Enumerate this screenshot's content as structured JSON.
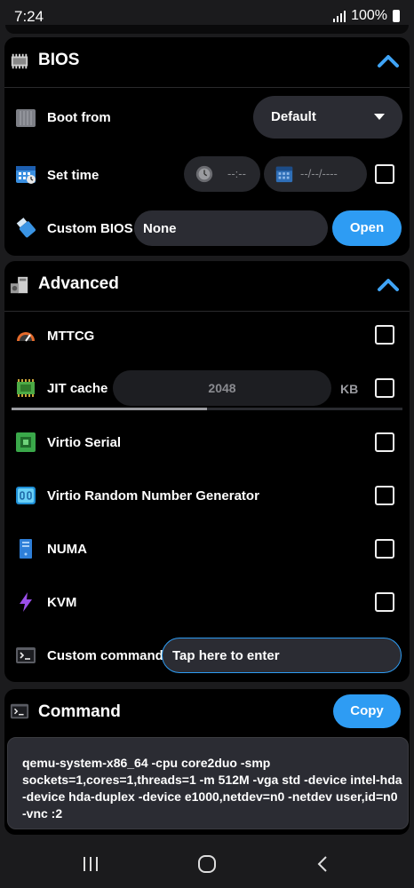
{
  "status": {
    "time": "7:24",
    "battery": "100%"
  },
  "bios": {
    "title": "BIOS",
    "boot_label": "Boot from",
    "boot_value": "Default",
    "settime_label": "Set time",
    "time_value": "--:--",
    "date_value": "--/--/----",
    "custom_bios_label": "Custom BIOS",
    "custom_bios_value": "None",
    "open_label": "Open"
  },
  "advanced": {
    "title": "Advanced",
    "mttcg_label": "MTTCG",
    "jit_label": "JIT cache",
    "jit_value": "2048",
    "jit_unit": "KB",
    "jit_progress": 0.5,
    "virtio_serial_label": "Virtio Serial",
    "virtio_rng_label": "Virtio Random Number Generator",
    "numa_label": "NUMA",
    "kvm_label": "KVM",
    "custom_cmd_label": "Custom command",
    "custom_cmd_placeholder": "Tap here to enter"
  },
  "command": {
    "title": "Command",
    "copy_label": "Copy",
    "text": "qemu-system-x86_64 -cpu core2duo -smp sockets=1,cores=1,threads=1 -m 512M -vga std -device intel-hda -device hda-duplex -device e1000,netdev=n0 -netdev user,id=n0 -vnc :2"
  },
  "colors": {
    "accent": "#2e9cf3",
    "background": "#000000",
    "field": "#2b2c33"
  }
}
